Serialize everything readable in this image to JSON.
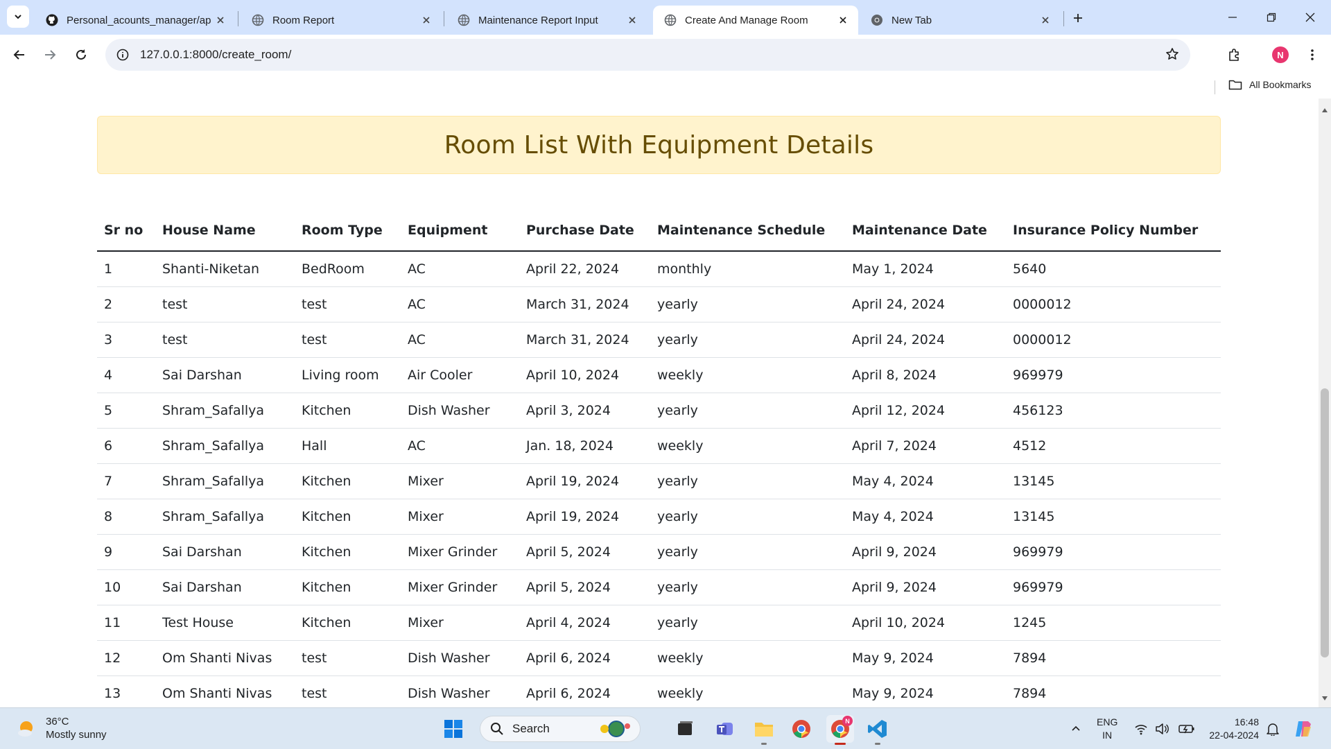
{
  "browser": {
    "tabs": [
      {
        "title": "Personal_acounts_manager/ap",
        "icon": "github-icon",
        "active": false
      },
      {
        "title": "Room Report",
        "icon": "globe-icon",
        "active": false
      },
      {
        "title": "Maintenance Report Input",
        "icon": "globe-icon",
        "active": false
      },
      {
        "title": "Create And Manage Room",
        "icon": "globe-icon",
        "active": true
      },
      {
        "title": "New Tab",
        "icon": "chrome-icon",
        "active": false
      }
    ],
    "url": "127.0.0.1:8000/create_room/",
    "profile_initial": "N",
    "bookmarks_label": "All Bookmarks"
  },
  "page": {
    "heading": "Room List With Equipment Details",
    "table": {
      "columns": [
        "Sr no",
        "House Name",
        "Room Type",
        "Equipment",
        "Purchase Date",
        "Maintenance Schedule",
        "Maintenance Date",
        "Insurance Policy Number"
      ],
      "rows": [
        [
          "1",
          "Shanti-Niketan",
          "BedRoom",
          "AC",
          "April 22, 2024",
          "monthly",
          "May 1, 2024",
          "5640"
        ],
        [
          "2",
          "test",
          "test",
          "AC",
          "March 31, 2024",
          "yearly",
          "April 24, 2024",
          "0000012"
        ],
        [
          "3",
          "test",
          "test",
          "AC",
          "March 31, 2024",
          "yearly",
          "April 24, 2024",
          "0000012"
        ],
        [
          "4",
          "Sai Darshan",
          "Living room",
          "Air Cooler",
          "April 10, 2024",
          "weekly",
          "April 8, 2024",
          "969979"
        ],
        [
          "5",
          "Shram_Safallya",
          "Kitchen",
          "Dish Washer",
          "April 3, 2024",
          "yearly",
          "April 12, 2024",
          "456123"
        ],
        [
          "6",
          "Shram_Safallya",
          "Hall",
          "AC",
          "Jan. 18, 2024",
          "weekly",
          "April 7, 2024",
          "4512"
        ],
        [
          "7",
          "Shram_Safallya",
          "Kitchen",
          "Mixer",
          "April 19, 2024",
          "yearly",
          "May 4, 2024",
          "13145"
        ],
        [
          "8",
          "Shram_Safallya",
          "Kitchen",
          "Mixer",
          "April 19, 2024",
          "yearly",
          "May 4, 2024",
          "13145"
        ],
        [
          "9",
          "Sai Darshan",
          "Kitchen",
          "Mixer Grinder",
          "April 5, 2024",
          "yearly",
          "April 9, 2024",
          "969979"
        ],
        [
          "10",
          "Sai Darshan",
          "Kitchen",
          "Mixer Grinder",
          "April 5, 2024",
          "yearly",
          "April 9, 2024",
          "969979"
        ],
        [
          "11",
          "Test House",
          "Kitchen",
          "Mixer",
          "April 4, 2024",
          "yearly",
          "April 10, 2024",
          "1245"
        ],
        [
          "12",
          "Om Shanti Nivas",
          "test",
          "Dish Washer",
          "April 6, 2024",
          "weekly",
          "May 9, 2024",
          "7894"
        ],
        [
          "13",
          "Om Shanti Nivas",
          "test",
          "Dish Washer",
          "April 6, 2024",
          "weekly",
          "May 9, 2024",
          "7894"
        ]
      ]
    }
  },
  "taskbar": {
    "weather": {
      "temp": "36°C",
      "condition": "Mostly sunny"
    },
    "search_placeholder": "Search",
    "lang_primary": "ENG",
    "lang_secondary": "IN",
    "time": "16:48",
    "date": "22-04-2024",
    "chrome_badge": "N"
  },
  "colors": {
    "tabstrip": "#d3e3fd",
    "banner_bg": "#fff3cd",
    "banner_text": "#664d03",
    "taskbar": "#dbe7f3"
  }
}
